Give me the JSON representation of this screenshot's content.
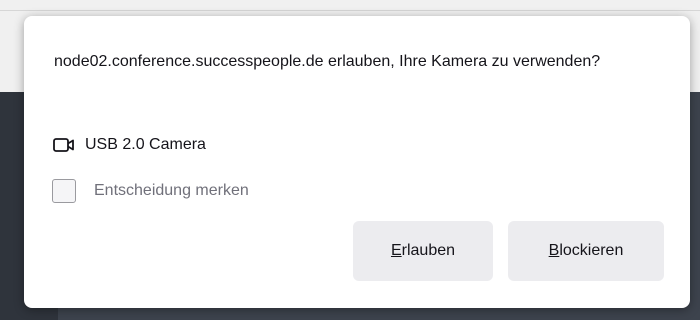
{
  "dialog": {
    "message": "node02.conference.successpeople.de erlauben, Ihre Kamera zu verwenden?",
    "device": {
      "icon": "camera-icon",
      "label": "USB 2.0 Camera"
    },
    "remember": {
      "label": "Entscheidung merken",
      "checked": false
    },
    "buttons": {
      "allow": {
        "accesskey": "E",
        "rest": "rlauben"
      },
      "block": {
        "accesskey": "B",
        "rest": "lockieren"
      }
    }
  },
  "colors": {
    "background_dark": "#3d434d",
    "panel": "#ffffff",
    "button": "#ececef",
    "text": "#15141a",
    "muted_text": "#70707a"
  }
}
